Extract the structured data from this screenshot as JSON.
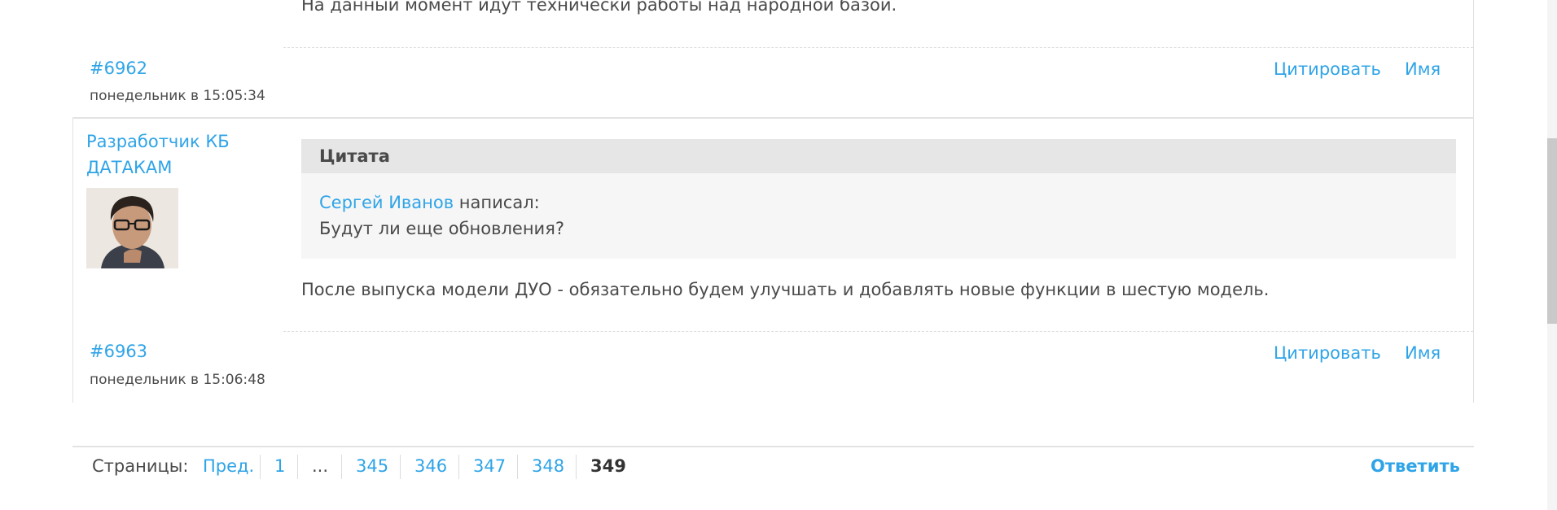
{
  "prev_post": {
    "text_tail": "На данный момент идут технически работы над народной базой.",
    "number": "#6962",
    "date": "понедельник в 15:05:34",
    "quote_label": "Цитировать",
    "name_label": "Имя"
  },
  "post": {
    "author": "Разработчик КБ ДАТАКАМ",
    "quote": {
      "title": "Цитата",
      "author": "Сергей Иванов",
      "wrote": "написал:",
      "text": "Будут ли еще обновления?"
    },
    "body": "После выпуска модели ДУО - обязательно будем улучшать и добавлять новые функции в шестую модель.",
    "number": "#6963",
    "date": "понедельник в 15:06:48",
    "quote_label": "Цитировать",
    "name_label": "Имя"
  },
  "pagination": {
    "label": "Страницы:",
    "prev": "Пред.",
    "pages": [
      "1",
      "...",
      "345",
      "346",
      "347",
      "348"
    ],
    "current": "349",
    "reply": "Ответить"
  },
  "colors": {
    "link": "#2fa4e7",
    "text": "#4a4a4a",
    "quote_bg": "#f6f6f6",
    "quote_head_bg": "#e6e6e6"
  }
}
